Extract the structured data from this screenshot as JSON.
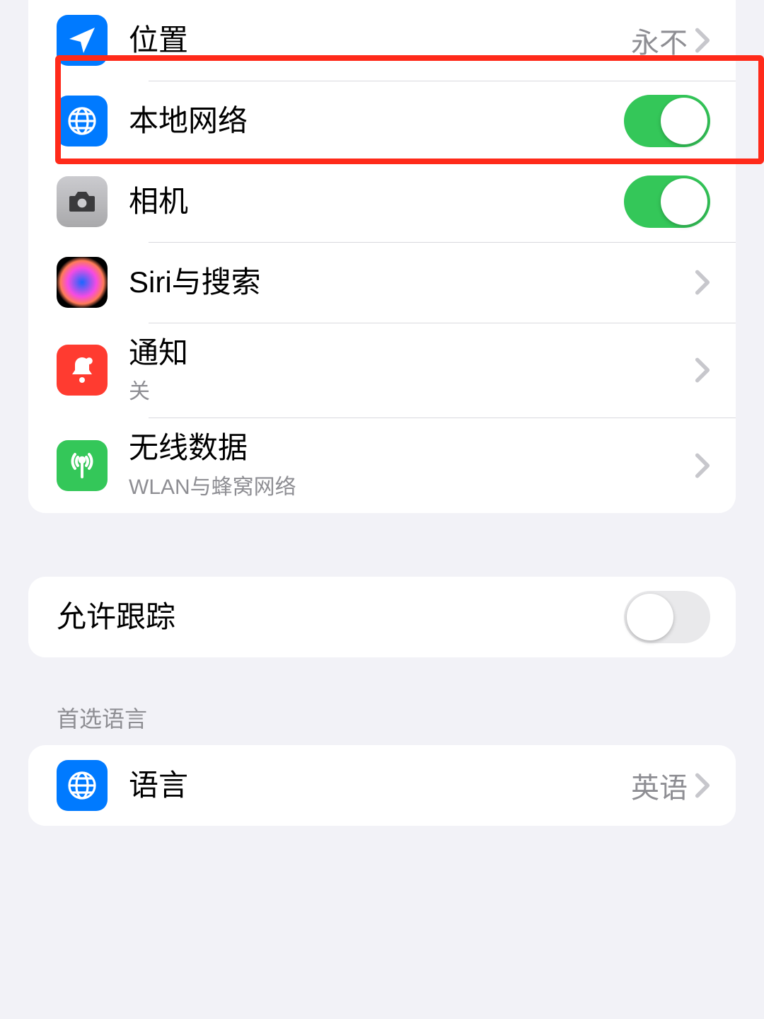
{
  "permissions": {
    "location": {
      "label": "位置",
      "value": "永不"
    },
    "local_network": {
      "label": "本地网络",
      "toggle_on": true
    },
    "camera": {
      "label": "相机",
      "toggle_on": true
    },
    "siri": {
      "label": "Siri与搜索"
    },
    "notifications": {
      "label": "通知",
      "sublabel": "关"
    },
    "wireless": {
      "label": "无线数据",
      "sublabel": "WLAN与蜂窝网络"
    }
  },
  "tracking": {
    "label": "允许跟踪",
    "toggle_on": false
  },
  "language_section": {
    "header": "首选语言",
    "language": {
      "label": "语言",
      "value": "英语"
    }
  }
}
